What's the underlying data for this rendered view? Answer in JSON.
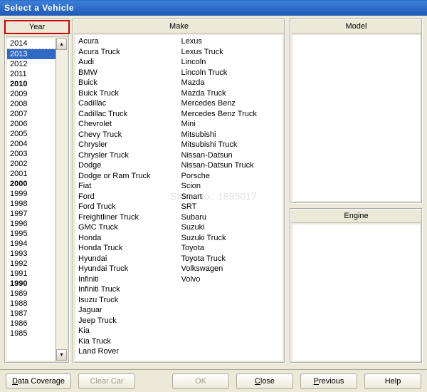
{
  "window": {
    "title": "Select a Vehicle"
  },
  "columns": {
    "year": "Year",
    "make": "Make",
    "model": "Model",
    "engine": "Engine"
  },
  "year": {
    "top": "2014",
    "selected": "2013",
    "bold": [
      "2010",
      "2000",
      "1990"
    ],
    "list": [
      "2013",
      "2012",
      "2011",
      "2010",
      "2009",
      "2008",
      "2007",
      "2006",
      "2005",
      "2004",
      "2003",
      "2002",
      "2001",
      "2000",
      "1999",
      "1998",
      "1997",
      "1996",
      "1995",
      "1994",
      "1993",
      "1992",
      "1991",
      "1990",
      "1989",
      "1988",
      "1987",
      "1986",
      "1985"
    ]
  },
  "makes": [
    "Acura",
    "Acura Truck",
    "Audi",
    "BMW",
    "Buick",
    "Buick Truck",
    "Cadillac",
    "Cadillac Truck",
    "Chevrolet",
    "Chevy Truck",
    "Chrysler",
    "Chrysler Truck",
    "Dodge",
    "Dodge or Ram Truck",
    "Fiat",
    "Ford",
    "Ford Truck",
    "Freightliner Truck",
    "GMC Truck",
    "Honda",
    "Honda Truck",
    "Hyundai",
    "Hyundai Truck",
    "Infiniti",
    "Infiniti Truck",
    "Isuzu Truck",
    "Jaguar",
    "Jeep Truck",
    "Kia",
    "Kia Truck",
    "Land Rover",
    "Lexus",
    "Lexus Truck",
    "Lincoln",
    "Lincoln Truck",
    "Mazda",
    "Mazda Truck",
    "Mercedes Benz",
    "Mercedes Benz Truck",
    "Mini",
    "Mitsubishi",
    "Mitsubishi Truck",
    "Nissan-Datsun",
    "Nissan-Datsun Truck",
    "Porsche",
    "Scion",
    "Smart",
    "SRT",
    "Subaru",
    "Suzuki",
    "Suzuki Truck",
    "Toyota",
    "Toyota Truck",
    "Volkswagen",
    "Volvo"
  ],
  "buttons": {
    "data_coverage": "Data Coverage",
    "clear_car": "Clear Car",
    "ok": "OK",
    "close": "Close",
    "previous": "Previous",
    "help": "Help"
  },
  "watermark": "Store No.: 1895017"
}
